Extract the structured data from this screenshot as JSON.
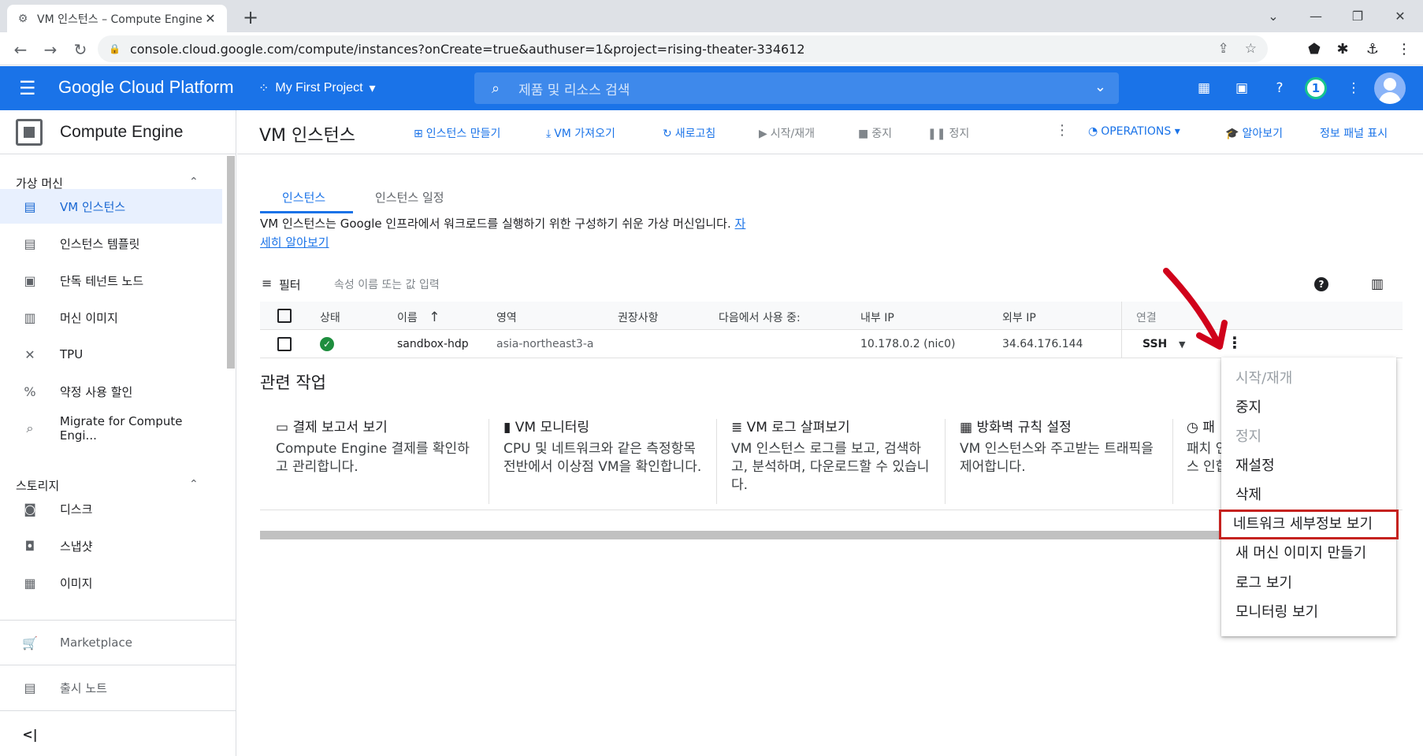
{
  "browser": {
    "tab_title": "VM 인스턴스 – Compute Engine",
    "url": "console.cloud.google.com/compute/instances?onCreate=true&authuser=1&project=rising-theater-334612"
  },
  "header": {
    "brand": "Google Cloud Platform",
    "project": "My First Project",
    "search_placeholder": "제품 및 리소스 검색",
    "notification_count": "1"
  },
  "sidebar": {
    "product": "Compute Engine",
    "section_vm": "가상 머신",
    "items_vm": [
      {
        "label": "VM 인스턴스",
        "icon": "vm-instance-icon"
      },
      {
        "label": "인스턴스 템플릿",
        "icon": "template-icon"
      },
      {
        "label": "단독 테넌트 노드",
        "icon": "node-icon"
      },
      {
        "label": "머신 이미지",
        "icon": "machine-image-icon"
      },
      {
        "label": "TPU",
        "icon": "tpu-icon"
      },
      {
        "label": "약정 사용 할인",
        "icon": "discount-icon"
      },
      {
        "label": "Migrate for Compute Engi...",
        "icon": "migrate-icon"
      }
    ],
    "section_storage": "스토리지",
    "items_storage": [
      {
        "label": "디스크",
        "icon": "disk-icon"
      },
      {
        "label": "스냅샷",
        "icon": "snapshot-icon"
      },
      {
        "label": "이미지",
        "icon": "image-icon"
      }
    ],
    "marketplace": "Marketplace",
    "release_notes": "출시 노트",
    "collapse": "<|"
  },
  "actionbar": {
    "title": "VM 인스턴스",
    "create": "인스턴스 만들기",
    "import": "VM 가져오기",
    "refresh": "새로고침",
    "start": "시작/재개",
    "stop": "중지",
    "suspend": "정지",
    "operations": "OPERATIONS",
    "learn": "알아보기",
    "info_panel": "정보 패널 표시"
  },
  "tabs": [
    "인스턴스",
    "인스턴스 일정"
  ],
  "description": {
    "text": "VM 인스턴스는 Google 인프라에서 워크로드를 실행하기 위한 구성하기 쉬운 가상 머신입니다.",
    "link": "자세히 알아보기"
  },
  "filter": {
    "label": "필터",
    "placeholder": "속성 이름 또는 값 입력"
  },
  "table": {
    "headers": [
      "상태",
      "이름",
      "영역",
      "권장사항",
      "다음에서 사용 중:",
      "내부 IP",
      "외부 IP",
      "연결"
    ],
    "rows": [
      {
        "status": "running",
        "name": "sandbox-hdp",
        "zone": "asia-northeast3-a",
        "recommendation": "",
        "in_use_by": "",
        "internal_ip": "10.178.0.2 (nic0)",
        "external_ip": "34.64.176.144",
        "connect": "SSH"
      }
    ]
  },
  "related": {
    "title": "관련 작업",
    "cards": [
      {
        "icon": "billing-icon",
        "title": "결제 보고서 보기",
        "desc": "Compute Engine 결제를 확인하고 관리합니다."
      },
      {
        "icon": "monitoring-icon",
        "title": "VM 모니터링",
        "desc": "CPU 및 네트워크와 같은 측정항목 전반에서 이상점 VM을 확인합니다."
      },
      {
        "icon": "logs-icon",
        "title": "VM 로그 살펴보기",
        "desc": "VM 인스턴스 로그를 보고, 검색하고, 분석하며, 다운로드할 수 있습니다."
      },
      {
        "icon": "firewall-icon",
        "title": "방화벽 규칙 설정",
        "desc": "VM 인스턴스와 주고받는 트래픽을 제어합니다."
      },
      {
        "icon": "patch-icon",
        "title": "패",
        "desc": "패치 인스 인합"
      }
    ]
  },
  "context_menu": [
    {
      "label": "시작/재개",
      "disabled": true
    },
    {
      "label": "중지",
      "disabled": false
    },
    {
      "label": "정지",
      "disabled": true
    },
    {
      "label": "재설정",
      "disabled": false
    },
    {
      "label": "삭제",
      "disabled": false
    },
    {
      "label": "네트워크 세부정보 보기",
      "disabled": false,
      "highlighted": true
    },
    {
      "label": "새 머신 이미지 만들기",
      "disabled": false
    },
    {
      "label": "로그 보기",
      "disabled": false
    },
    {
      "label": "모니터링 보기",
      "disabled": false
    }
  ],
  "colors": {
    "header": "#1a73e8",
    "highlight_border": "#c5221f",
    "annotation_arrow": "#d0021b",
    "status_ok": "#1e8e3e"
  }
}
